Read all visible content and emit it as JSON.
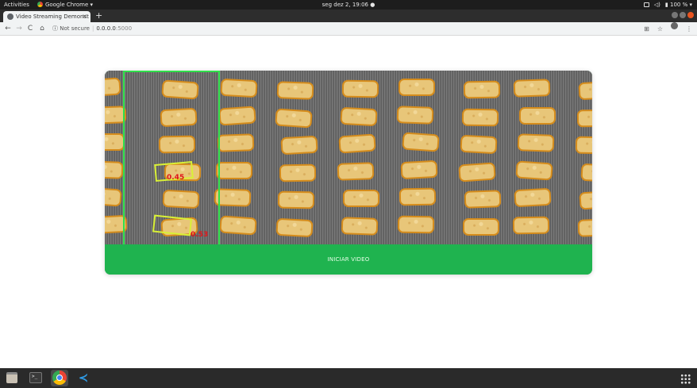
{
  "topbar": {
    "activities": "Activities",
    "app_name": "Google Chrome ▾",
    "clock": "seg dez  2, 19:06 ●",
    "battery": "100 % ▾"
  },
  "browser": {
    "tab_title": "Video Streaming Demonst",
    "tab_close": "×",
    "new_tab": "+",
    "security": "Not secure",
    "url_host": "0.0.0.0",
    "url_port": ":5000"
  },
  "nav": {
    "back": "←",
    "forward": "→",
    "reload": "C",
    "home": "⌂",
    "info": "ⓘ",
    "translate": "⊞",
    "star": "☆",
    "menu": "⋮"
  },
  "video": {
    "detections": [
      {
        "label": "0.45"
      },
      {
        "label": "0.53"
      }
    ]
  },
  "main": {
    "start_button": "INICIAR VIDEO"
  },
  "dock": {
    "terminal_prompt": ">_"
  },
  "colors": {
    "button_green": "#1fb34f",
    "roi_line": "#2fe04a",
    "detection_box": "#d9f036",
    "score_text": "#e0161b"
  }
}
